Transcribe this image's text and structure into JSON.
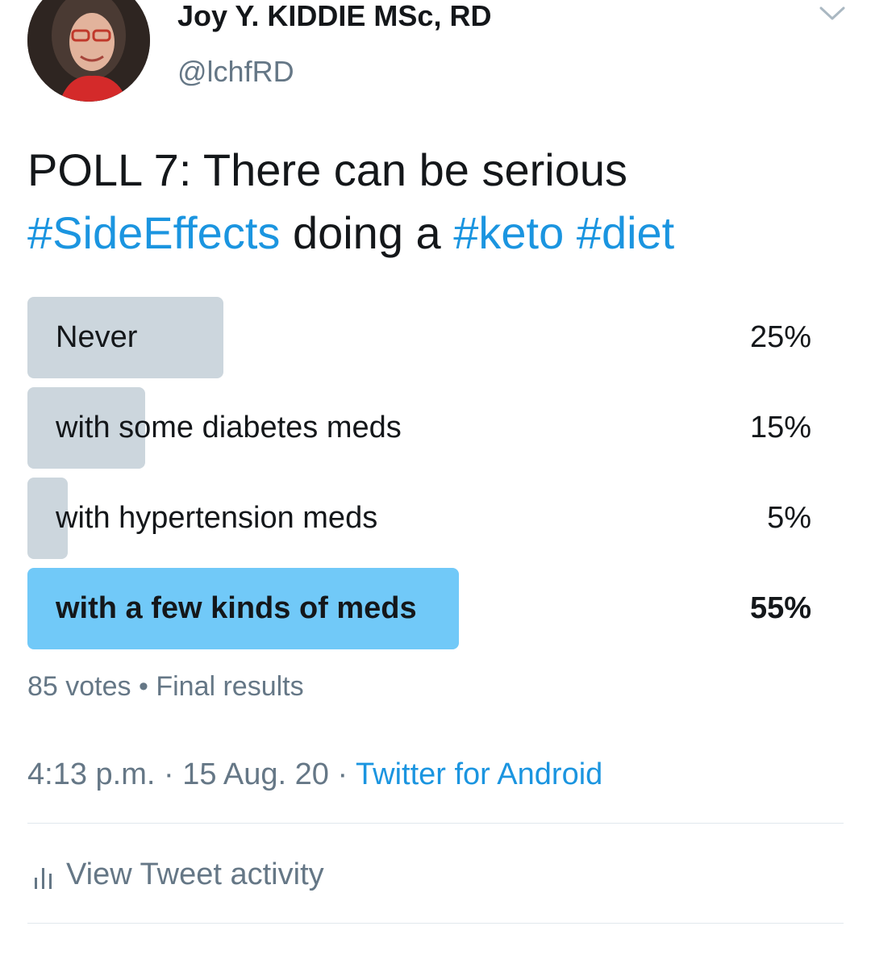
{
  "author": {
    "display_name": "Joy Y. KIDDIE MSc, RD",
    "handle": "@lchfRD",
    "avatar": "avatar-photo"
  },
  "tweet": {
    "text_line1": "POLL 7: There can be serious",
    "hashtag_side_effects": "#SideEffects",
    "text_mid": " doing a ",
    "hashtag_keto": "#keto",
    "hashtag_diet": "#diet"
  },
  "poll": {
    "options": [
      {
        "label": "Never",
        "percent_text": "25%",
        "percent": 25
      },
      {
        "label": "with some diabetes meds",
        "percent_text": "15%",
        "percent": 15
      },
      {
        "label": "with hypertension meds",
        "percent_text": "5%",
        "percent": 5
      },
      {
        "label": "with a few kinds of meds",
        "percent_text": "55%",
        "percent": 55,
        "winner": true
      }
    ],
    "votes": "85 votes",
    "separator": "•",
    "status": "Final results"
  },
  "meta": {
    "time": "4:13 p.m.",
    "date": "15 Aug. 20",
    "separator": "·",
    "source": "Twitter for Android"
  },
  "activity": {
    "label": "View Tweet activity",
    "icon": "bar-chart-icon"
  },
  "colors": {
    "link": "#1b95e0",
    "secondary_text": "#657786",
    "poll_bar": "#ccd6dd",
    "poll_bar_winner": "#71c9f8"
  }
}
